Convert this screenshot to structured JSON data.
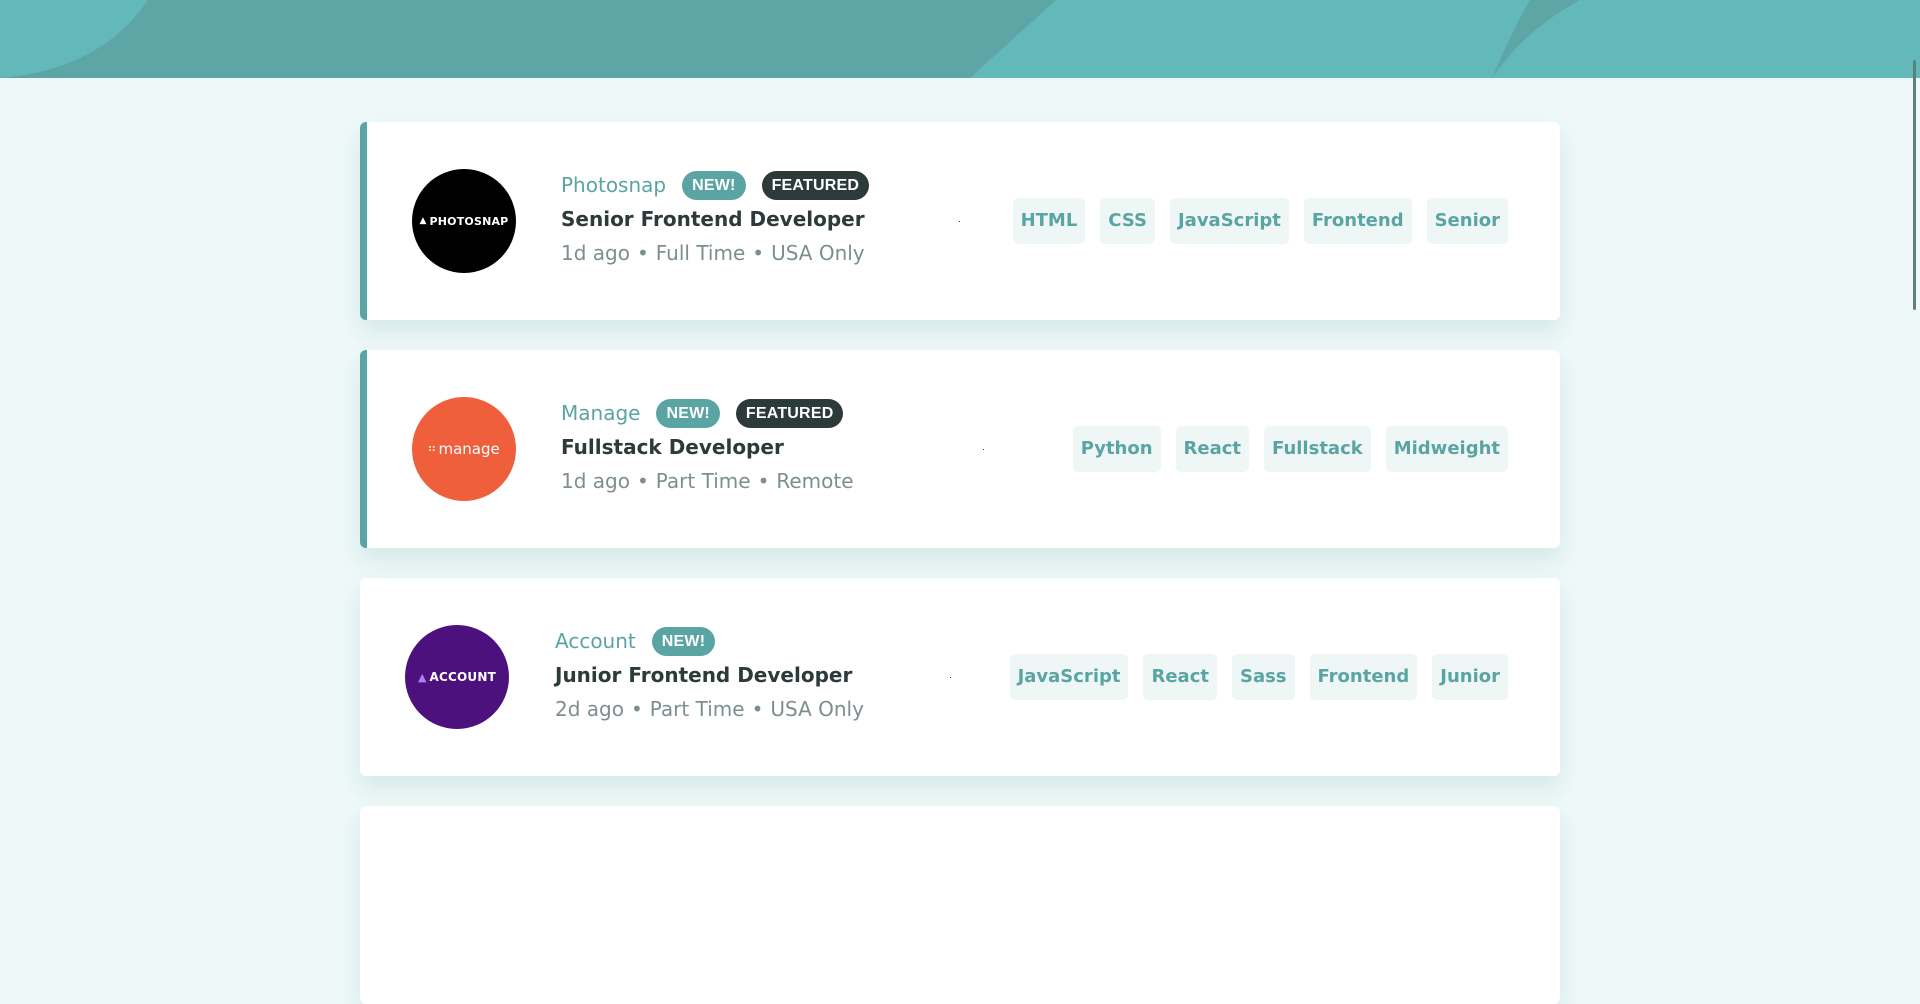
{
  "jobs": [
    {
      "company": "Photosnap",
      "logo_text": "PHOTOSNAP",
      "logo_color": "#000000",
      "new_label": "NEW!",
      "featured_label": "FEATURED",
      "position": "Senior Frontend Developer",
      "posted": "1d ago",
      "contract": "Full Time",
      "location": "USA Only",
      "tags": [
        "HTML",
        "CSS",
        "JavaScript",
        "Frontend",
        "Senior"
      ]
    },
    {
      "company": "Manage",
      "logo_text": "manage",
      "logo_color": "#ef5f3c",
      "new_label": "NEW!",
      "featured_label": "FEATURED",
      "position": "Fullstack Developer",
      "posted": "1d ago",
      "contract": "Part Time",
      "location": "Remote",
      "tags": [
        "Python",
        "React",
        "Fullstack",
        "Midweight"
      ]
    },
    {
      "company": "Account",
      "logo_text": "ACCOUNT",
      "logo_color": "#4d117d",
      "new_label": "NEW!",
      "position": "Junior Frontend Developer",
      "posted": "2d ago",
      "contract": "Part Time",
      "location": "USA Only",
      "tags": [
        "JavaScript",
        "React",
        "Sass",
        "Frontend",
        "Junior"
      ]
    }
  ],
  "separator": "•",
  "colors": {
    "primary": "#5ba4a4",
    "background": "#eef8f8",
    "dark": "#2c3a3a",
    "muted": "#7c8f8f",
    "tag_bg": "#eef6f6"
  }
}
